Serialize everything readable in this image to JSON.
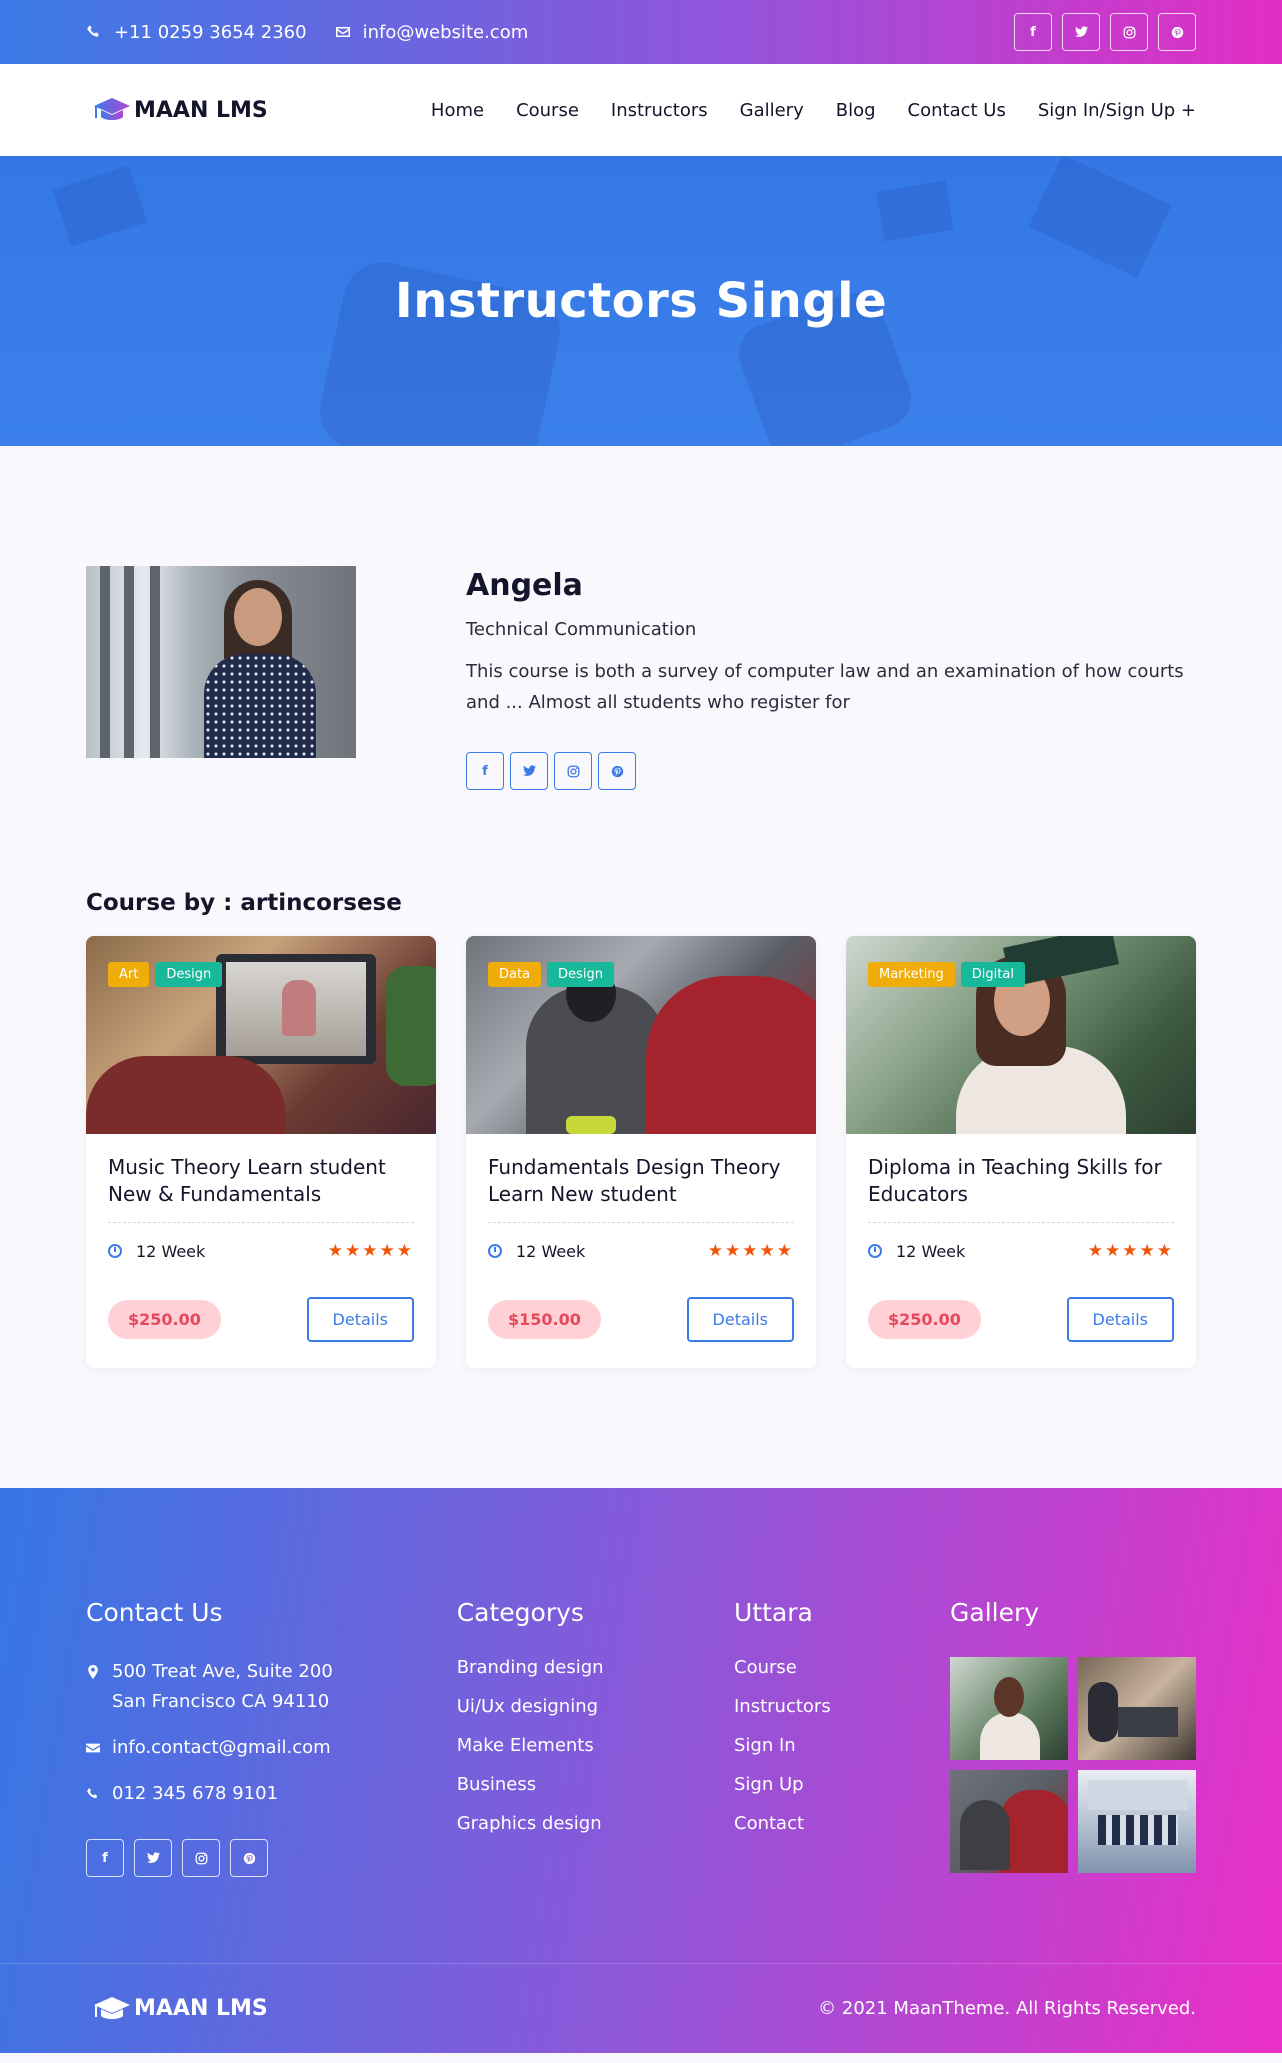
{
  "topbar": {
    "phone": "+11 0259 3654 2360",
    "email": "info@website.com",
    "social": [
      "f",
      "t",
      "ig",
      "p"
    ]
  },
  "nav": {
    "logo_text": "MAAN LMS",
    "items": [
      "Home",
      "Course",
      "Instructors",
      "Gallery",
      "Blog",
      "Contact Us",
      "Sign In/Sign Up +"
    ]
  },
  "hero": {
    "title": "Instructors Single"
  },
  "instructor": {
    "name": "Angela",
    "role": "Technical Communication",
    "bio": "This course is both a survey of computer law and an examination of how courts and ... Almost all students who register for"
  },
  "courses": {
    "heading": "Course by : artincorsese",
    "items": [
      {
        "tags": [
          "Art",
          "Design"
        ],
        "title": "Music Theory Learn student New & Fundamentals",
        "duration": "12 Week",
        "rating": 5,
        "price": "$250.00",
        "button": "Details"
      },
      {
        "tags": [
          "Data",
          "Design"
        ],
        "title": "Fundamentals Design Theory Learn New student",
        "duration": "12 Week",
        "rating": 5,
        "price": "$150.00",
        "button": "Details"
      },
      {
        "tags": [
          "Marketing",
          "Digital"
        ],
        "title": "Diploma in Teaching Skills for Educators",
        "duration": "12 Week",
        "rating": 5,
        "price": "$250.00",
        "button": "Details"
      }
    ]
  },
  "footer": {
    "contact": {
      "heading": "Contact Us",
      "address": "500 Treat Ave, Suite 200 San Francisco CA 94110",
      "email": "info.contact@gmail.com",
      "phone": "012 345 678 9101"
    },
    "categories": {
      "heading": "Categorys",
      "items": [
        "Branding design",
        "Ui/Ux designing",
        "Make Elements",
        "Business",
        "Graphics design"
      ]
    },
    "uttara": {
      "heading": "Uttara",
      "items": [
        "Course",
        "Instructors",
        "Sign In",
        "Sign Up",
        "Contact"
      ]
    },
    "gallery": {
      "heading": "Gallery"
    },
    "logo_text": "MAAN LMS",
    "copyright": "© 2021 MaanTheme. All Rights Reserved."
  },
  "colors": {
    "primary": "#3b7be6",
    "gradient_start": "#3a7be6",
    "gradient_end": "#e32ec5",
    "tag_yellow": "#f0ad0a",
    "tag_green": "#17b99a",
    "star": "#f0560a",
    "price_bg": "#ffd1d6",
    "price_text": "#e8485c"
  }
}
